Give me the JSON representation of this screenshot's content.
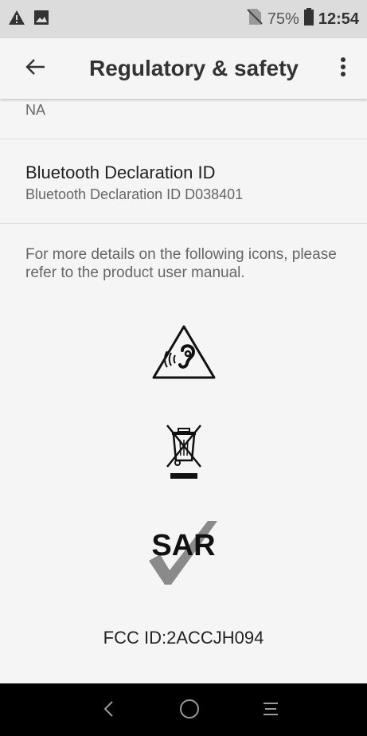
{
  "status_bar": {
    "icons_left": [
      "warning-icon",
      "image-notification-icon"
    ],
    "icons_right": [
      "no-sim-icon",
      "battery-icon"
    ],
    "battery_percent": "75%",
    "time": "12:54",
    "battery_level": 0.75
  },
  "app_bar": {
    "title": "Regulatory & safety",
    "back_icon": "arrow-left-icon",
    "more_icon": "more-vert-icon"
  },
  "content": {
    "partial_item_summary": "NA",
    "bluetooth": {
      "title": "Bluetooth Declaration ID",
      "summary": "Bluetooth Declaration ID D038401"
    },
    "note": "For more details on the following icons, please refer to the product user manual.",
    "icons": [
      "hearing-warning-icon",
      "weee-crossed-bin-icon",
      "sar-check-icon"
    ],
    "sar_label": "SAR",
    "fcc_id": "FCC ID:2ACCJH094"
  },
  "nav_bar": {
    "buttons": [
      "back-nav-icon",
      "home-nav-icon",
      "recents-nav-icon"
    ]
  },
  "colors": {
    "status_bar_bg": "#dcdcdc",
    "page_bg": "#f5f5f5",
    "nav_bar_bg": "#000000",
    "sar_check": "#8a8a8a"
  }
}
